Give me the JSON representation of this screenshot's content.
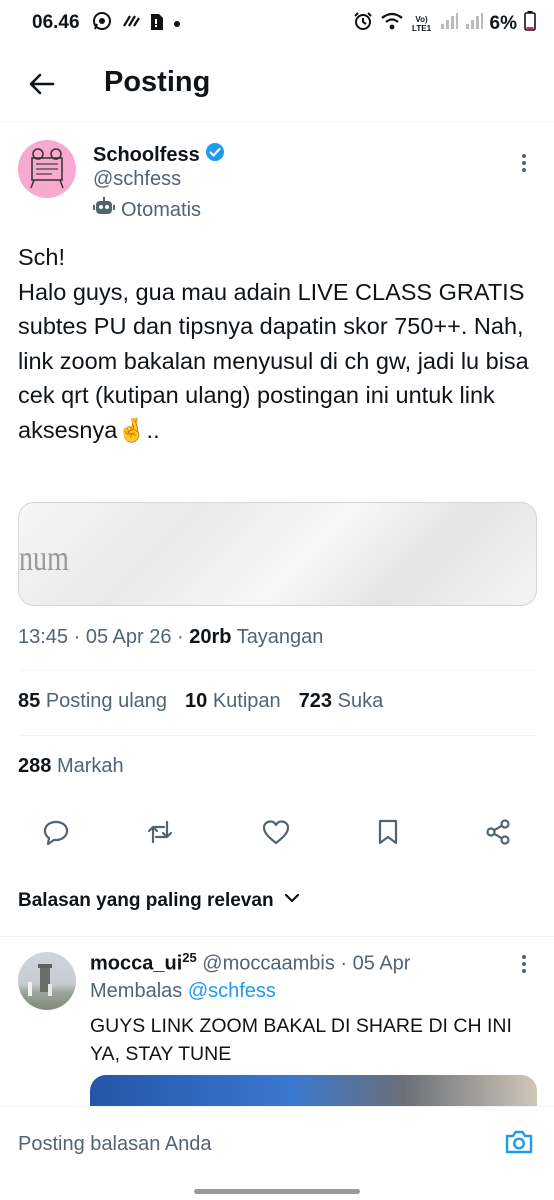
{
  "status_bar": {
    "time": "06.46",
    "network_label": "Vo) LTE1",
    "battery": "6%"
  },
  "header": {
    "title": "Posting"
  },
  "post": {
    "author_name": "Schoolfess",
    "author_handle": "@schfess",
    "automated_label": "Otomatis",
    "text": "Sch!\nHalo guys, gua mau adain LIVE CLASS GRATIS subtes PU dan tipsnya dapatin skor 750++. Nah, link zoom bakalan menyusul di ch gw, jadi lu bisa cek qrt (kutipan ulang) postingan ini untuk link aksesnya🤞..",
    "media_text": "num",
    "timestamp": "13:45 · 05 Apr 26 · ",
    "views_count": "20rb",
    "views_label": "Tayangan",
    "stats": {
      "reposts": "85",
      "reposts_label": "Posting ulang",
      "quotes": "10",
      "quotes_label": "Kutipan",
      "likes": "723",
      "likes_label": "Suka",
      "bookmarks": "288",
      "bookmarks_label": "Markah"
    }
  },
  "replies_sort_label": "Balasan yang paling relevan",
  "reply": {
    "name": "mocca_ui",
    "name_sup": "25",
    "handle_date": "@moccaambis · 05 Apr",
    "replying_prefix": "Membalas",
    "replying_to": "@schfess",
    "text": "GUYS LINK ZOOM BAKAL DI SHARE DI CH INI YA, STAY TUNE"
  },
  "composer": {
    "placeholder": "Posting balasan Anda"
  },
  "colors": {
    "accent": "#1d9bf0",
    "secondary_text": "#536471",
    "avatar_bg": "#f7a9cf"
  }
}
